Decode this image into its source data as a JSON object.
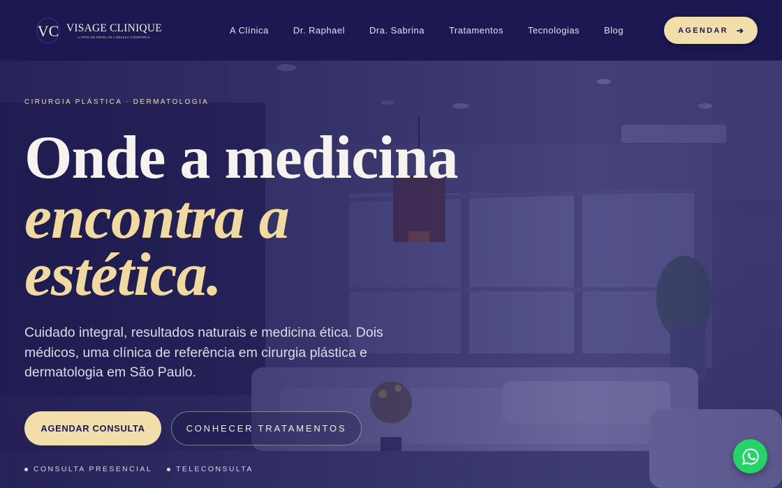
{
  "brand": {
    "name": "VISAGE CLINIQUE",
    "tagline": "A ARTE DE REVELAR A BELEZA ATEMPORAL",
    "monogram": "VC",
    "accent_color": "#f1deab",
    "navy_color": "#1b1852"
  },
  "nav": {
    "items": [
      {
        "label": "A Clínica"
      },
      {
        "label": "Dr. Raphael"
      },
      {
        "label": "Dra. Sabrina"
      },
      {
        "label": "Tratamentos"
      },
      {
        "label": "Tecnologias"
      },
      {
        "label": "Blog"
      }
    ],
    "cta_label": "AGENDAR",
    "cta_icon": "arrow-right-icon"
  },
  "hero": {
    "eyebrow": "CIRURGIA PLÁSTICA · DERMATOLOGIA",
    "headline_line1": "Onde a medicina",
    "headline_line2": "encontra a",
    "headline_line3": "estética.",
    "lead": "Cuidado integral, resultados naturais e medicina ética. Dois médicos, uma clínica de referência em cirurgia plástica e dermatologia em São Paulo.",
    "primary_button": "AGENDAR CONSULTA",
    "secondary_button": "CONHECER TRATAMENTOS",
    "badges": [
      {
        "label": "CONSULTA PRESENCIAL"
      },
      {
        "label": "TELECONSULTA"
      }
    ]
  },
  "floating": {
    "whatsapp_icon": "whatsapp-icon",
    "whatsapp_color": "#25d366"
  }
}
